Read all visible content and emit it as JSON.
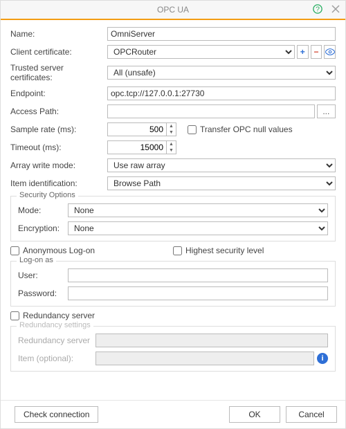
{
  "title": "OPC UA",
  "labels": {
    "name": "Name:",
    "clientCert": "Client certificate:",
    "trustedCerts": "Trusted server certificates:",
    "endpoint": "Endpoint:",
    "accessPath": "Access Path:",
    "sampleRate": "Sample rate (ms):",
    "timeout": "Timeout (ms):",
    "arrayWrite": "Array write mode:",
    "itemIdent": "Item identification:",
    "securityOptions": "Security Options",
    "mode": "Mode:",
    "encryption": "Encryption:",
    "anonLogon": "Anonymous Log-on",
    "highestSec": "Highest security level",
    "logonAs": "Log-on as",
    "user": "User:",
    "password": "Password:",
    "redundancyServer": "Redundancy server",
    "redundancySettings": "Redundancy settings",
    "redundancyServer2": "Redundancy server",
    "itemOptional": "Item (optional):",
    "transferNull": "Transfer OPC null values",
    "ellipsis": "..."
  },
  "values": {
    "name": "OmniServer",
    "clientCert": "OPCRouter",
    "trustedCerts": "All (unsafe)",
    "endpoint": "opc.tcp://127.0.0.1:27730",
    "accessPath": "",
    "sampleRate": "500",
    "timeout": "15000",
    "arrayWrite": "Use raw array",
    "itemIdent": "Browse Path",
    "mode": "None",
    "encryption": "None",
    "user": "",
    "password": "",
    "redundancyServer": "",
    "itemOptional": ""
  },
  "checks": {
    "transferNull": false,
    "anonLogon": false,
    "highestSec": false,
    "redundancy": false
  },
  "buttons": {
    "checkConnection": "Check connection",
    "ok": "OK",
    "cancel": "Cancel"
  }
}
